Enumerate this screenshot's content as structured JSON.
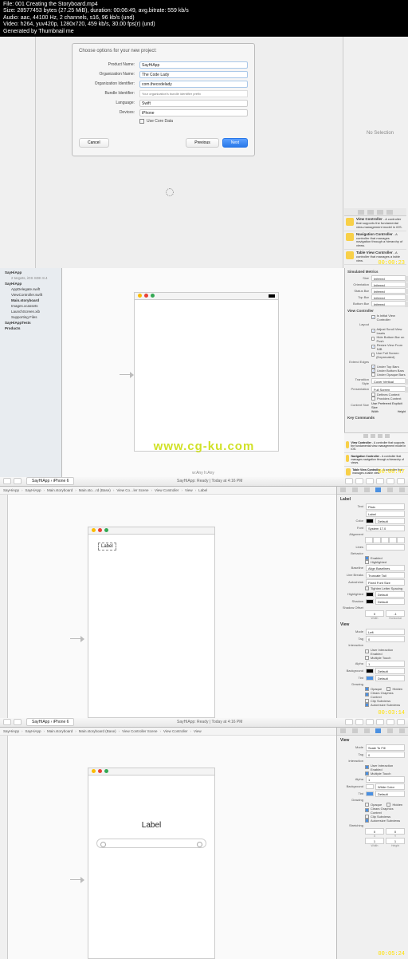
{
  "overlay": {
    "l1": "File: 001 Creating the Storyboard.mp4",
    "l2": "Size: 28577453 bytes (27.25 MiB), duration: 00:06:49, avg.bitrate: 559 kb/s",
    "l3": "Audio: aac, 44100 Hz, 2 channels, s16, 96 kb/s (und)",
    "l4": "Video: h264, yuv420p, 1280x720, 459 kb/s, 30.00 fps(r) (und)",
    "l5": "Generated by Thumbnail me"
  },
  "f1": {
    "modal_title": "Choose options for your new project:",
    "fields": {
      "product_label": "Product Name:",
      "product_value": "SayHiApp",
      "org_label": "Organization Name:",
      "org_value": "The Code Lady",
      "orgid_label": "Organization Identifier:",
      "orgid_value": "com.thecodelady",
      "bundle_label": "Bundle Identifier:",
      "bundle_hint": "Your organization's bundle identifier prefix",
      "lang_label": "Language:",
      "lang_value": "Swift",
      "dev_label": "Devices:",
      "dev_value": "iPhone",
      "coredata": "Use Core Data"
    },
    "btn_cancel": "Cancel",
    "btn_prev": "Previous",
    "btn_next": "Next",
    "no_selection": "No Selection",
    "lib": {
      "vc_title": "View Controller",
      "vc_desc": "- A controller that supports the fundamental view-management model in iOS.",
      "nc_title": "Navigation Controller",
      "nc_desc": "- A controller that manages navigation through a hierarchy of views.",
      "tvc_title": "Table View Controller",
      "tvc_desc": "- A controller that manages a table view."
    },
    "timestamp": "00:00:23"
  },
  "f2": {
    "tree": {
      "root": "SayHiApp",
      "targets": "2 targets, iOS SDK 8.4",
      "folder1": "SayHiApp",
      "items": [
        "AppDelegate.swift",
        "ViewController.swift",
        "Main.storyboard",
        "Images.xcassets",
        "LaunchScreen.xib",
        "Supporting Files"
      ],
      "folder2": "SayHiAppTests",
      "folder3": "Products"
    },
    "insp": {
      "sim_title": "Simulated Metrics",
      "size_l": "Size",
      "size_v": "Inferred",
      "orient_l": "Orientation",
      "orient_v": "Inferred",
      "status_l": "Status Bar",
      "status_v": "Inferred",
      "top_l": "Top Bar",
      "top_v": "Inferred",
      "bot_l": "Bottom Bar",
      "bot_v": "Inferred",
      "vc_title": "View Controller",
      "initial": "Is Initial View Controller",
      "layout_l": "Layout",
      "layout1": "Adjust Scroll View Insets",
      "layout2": "Hide Bottom Bar on Push",
      "layout3": "Resize View From NIB",
      "layout4": "Use Full Screen (Deprecated)",
      "extend_l": "Extend Edges",
      "extend1": "Under Top Bars",
      "extend2": "Under Bottom Bars",
      "extend3": "Under Opaque Bars",
      "trans_l": "Transition Style",
      "trans_v": "Cover Vertical",
      "pres_l": "Presentation",
      "pres_v": "Full Screen",
      "def_ctx": "Defines Context",
      "prov_ctx": "Provides Context",
      "csize_l": "Content Size",
      "csize_v": "Use Preferred Explicit Size",
      "width_l": "Width",
      "height_l": "Height",
      "keycmd": "Key Commands"
    },
    "lib": {
      "vc_title": "View Controller",
      "vc_desc": "- A controller that supports the fundamental view-management model in iOS.",
      "nc_title": "Navigation Controller",
      "nc_desc": "- A controller that manages navigation through a hierarchy of views.",
      "tvc_title": "Table View Controller",
      "tvc_desc": "- A controller that manages a table view."
    },
    "watermark": "www.cg-ku.com",
    "status_wAny": "w:Any h:Any",
    "timestamp": "00:00:47"
  },
  "f3": {
    "app": "SayHiApp",
    "device": "iPhone 6",
    "status": "SayHiApp: Ready | Today at 4:16 PM",
    "crumbs": [
      "SayHiApp",
      "SayHiApp",
      "Main.storyboard",
      "Main.sto…rd (Base)",
      "View Co…ler Scene",
      "View Controller",
      "View",
      "Label"
    ],
    "label_text": "Label",
    "insp": {
      "title": "Label",
      "text_l": "Text",
      "text_v": "Plain",
      "text_val": "Label",
      "color_l": "Color",
      "color_v": "Default",
      "font_l": "Font",
      "font_v": "System 17.0",
      "align_l": "Alignment",
      "lines_l": "Lines",
      "behav_l": "Behavior",
      "behav1": "Enabled",
      "behav2": "Highlighted",
      "base_l": "Baseline",
      "base_v": "Align Baselines",
      "lbrk_l": "Line Breaks",
      "lbrk_v": "Truncate Tail",
      "ashr_l": "Autoshrink",
      "ashr_v": "Fixed Font Size",
      "tight": "Tighten Letter Spacing",
      "hl_l": "Highlighted",
      "hl_v": "Default",
      "sh_l": "Shadow",
      "sh_v": "Default",
      "sho_l": "Shadow Offset",
      "sho_w": "0",
      "sho_h": "-1",
      "sho_wl": "Width",
      "sho_hl": "Horizontal",
      "view_title": "View",
      "mode_l": "Mode",
      "mode_v": "Left",
      "tag_l": "Tag",
      "tag_v": "0",
      "inter_l": "Interaction",
      "inter1": "User Interaction Enabled",
      "inter2": "Multiple Touch",
      "alpha_l": "Alpha",
      "alpha_v": "1",
      "bg_l": "Background",
      "bg_v": "Default",
      "tint_l": "Tint",
      "tint_v": "Default",
      "draw_l": "Drawing",
      "draw1": "Opaque",
      "draw2": "Hidden",
      "draw3": "Clears Graphics Context",
      "draw4": "Clip Subviews",
      "draw5": "Autoresize Subviews"
    },
    "timestamp": "00:03:14"
  },
  "f4": {
    "app": "SayHiApp",
    "device": "iPhone 6",
    "status": "SayHiApp: Ready | Today at 4:16 PM",
    "crumbs": [
      "SayHiApp",
      "SayHiApp",
      "Main.storyboard",
      "Main.storyboard (Base)",
      "View Controller Scene",
      "View Controller",
      "View"
    ],
    "label_text": "Label",
    "insp": {
      "view_title": "View",
      "mode_l": "Mode",
      "mode_v": "Scale To Fill",
      "tag_l": "Tag",
      "tag_v": "0",
      "inter_l": "Interaction",
      "inter1": "User Interaction Enabled",
      "inter2": "Multiple Touch",
      "alpha_l": "Alpha",
      "alpha_v": "1",
      "bg_l": "Background",
      "bg_v": "White Color",
      "tint_l": "Tint",
      "tint_v": "Default",
      "draw_l": "Drawing",
      "draw1": "Opaque",
      "draw2": "Hidden",
      "draw3": "Clears Graphics Context",
      "draw4": "Clip Subviews",
      "draw5": "Autoresize Subviews",
      "stretch_l": "Stretching",
      "sx": "0",
      "sy": "0",
      "sw": "1",
      "sh": "1",
      "sx_l": "X",
      "sy_l": "Y",
      "sw_l": "Width",
      "sh_l": "Height"
    },
    "timestamp": "00:05:24"
  }
}
